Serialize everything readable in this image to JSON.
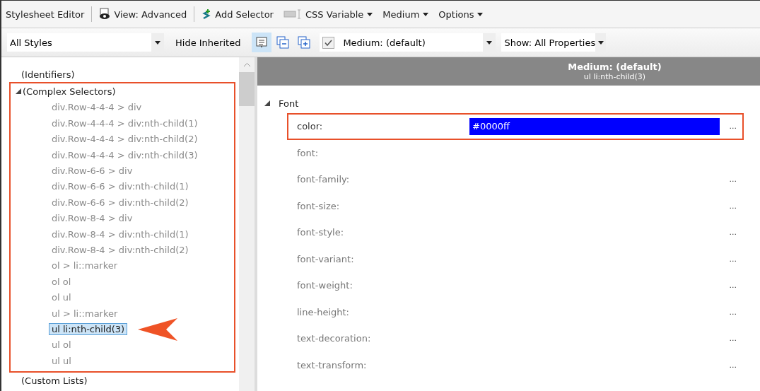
{
  "toolbar": {
    "items": [
      {
        "kind": "title",
        "label": "Stylesheet Editor"
      },
      {
        "kind": "view",
        "label": "View: Advanced"
      },
      {
        "kind": "add",
        "label": "Add Selector"
      },
      {
        "kind": "variable",
        "label": "CSS Variable",
        "dropdown": true,
        "disabled": false
      },
      {
        "kind": "plain",
        "label": "Medium",
        "dropdown": true
      },
      {
        "kind": "plain",
        "label": "Options",
        "dropdown": true
      }
    ]
  },
  "filter_bar": {
    "styles": "All Styles",
    "hide_inherited": "Hide Inherited",
    "view_buttons": [
      {
        "kind": "list",
        "selected": true
      },
      {
        "kind": "collapse",
        "selected": false
      },
      {
        "kind": "expand",
        "selected": false
      }
    ],
    "medium_checked": true,
    "medium": "Medium: (default)",
    "show": "Show: All Properties"
  },
  "tree": {
    "items": [
      {
        "label": "(Identifiers)"
      },
      {
        "label": "(Complex Selectors)",
        "expanded": true,
        "highlighted": true,
        "children": [
          {
            "label": "div.Row-4-4-4 > div",
            "selected": false
          },
          {
            "label": "div.Row-4-4-4 > div:nth-child(1)",
            "selected": false
          },
          {
            "label": "div.Row-4-4-4 > div:nth-child(2)",
            "selected": false
          },
          {
            "label": "div.Row-4-4-4 > div:nth-child(3)",
            "selected": false
          },
          {
            "label": "div.Row-6-6 > div",
            "selected": false
          },
          {
            "label": "div.Row-6-6 > div:nth-child(1)",
            "selected": false
          },
          {
            "label": "div.Row-6-6 > div:nth-child(2)",
            "selected": false
          },
          {
            "label": "div.Row-8-4 > div",
            "selected": false
          },
          {
            "label": "div.Row-8-4 > div:nth-child(1)",
            "selected": false
          },
          {
            "label": "div.Row-8-4 > div:nth-child(2)",
            "selected": false
          },
          {
            "label": "ol > li::marker",
            "selected": false
          },
          {
            "label": "ol ol",
            "selected": false
          },
          {
            "label": "ol ul",
            "selected": false
          },
          {
            "label": "ul > li::marker",
            "selected": false
          },
          {
            "label": "ul li:nth-child(3)",
            "selected": true
          },
          {
            "label": "ul ol",
            "selected": false
          },
          {
            "label": "ul ul",
            "selected": false
          }
        ]
      },
      {
        "label": "(Custom Lists)"
      }
    ]
  },
  "properties": {
    "header_title": "Medium: (default)",
    "header_selector": "ul li:nth-child(3)",
    "group": {
      "label": "Font",
      "expanded": true
    },
    "rows": [
      {
        "name": "color:",
        "value": "#0000ff",
        "value_selected": true,
        "highlighted": true,
        "more": "..."
      },
      {
        "name": "font:",
        "highlighted": false
      },
      {
        "name": "font-family:",
        "highlighted": false,
        "more": "..."
      },
      {
        "name": "font-size:",
        "highlighted": false,
        "more": "..."
      },
      {
        "name": "font-style:",
        "highlighted": false,
        "more": "..."
      },
      {
        "name": "font-variant:",
        "highlighted": false,
        "more": "..."
      },
      {
        "name": "font-weight:",
        "highlighted": false,
        "more": "..."
      },
      {
        "name": "line-height:",
        "highlighted": false,
        "more": "..."
      },
      {
        "name": "text-decoration:",
        "highlighted": false,
        "more": "..."
      },
      {
        "name": "text-transform:",
        "highlighted": false,
        "more": "..."
      }
    ]
  }
}
